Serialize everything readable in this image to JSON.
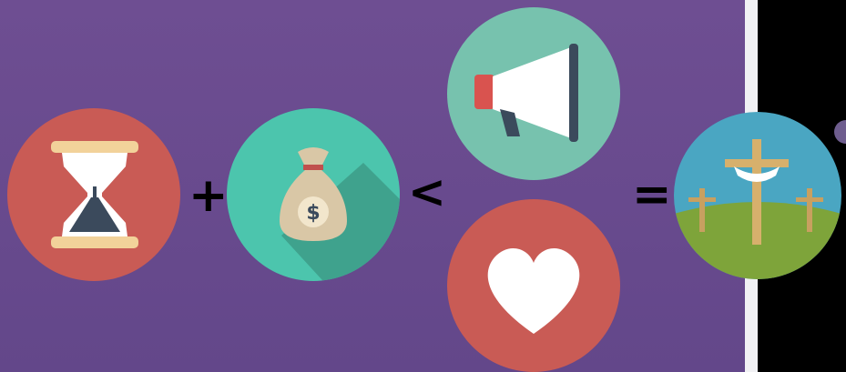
{
  "operators": {
    "plus": "+",
    "less_than": "<",
    "equals": "="
  },
  "icons": [
    {
      "name": "hourglass-icon",
      "color": "#c95b55"
    },
    {
      "name": "money-bag-icon",
      "color": "#4cc5ad"
    },
    {
      "name": "megaphone-icon",
      "color": "#77c2ae"
    },
    {
      "name": "heart-icon",
      "color": "#c95b55"
    },
    {
      "name": "crosses-hill-icon",
      "color": "#4aa6c2"
    }
  ],
  "money_bag": {
    "symbol": "$"
  },
  "colors": {
    "background": "#694c8f",
    "divider": "#f1f1f4",
    "right_panel": "#000000"
  }
}
